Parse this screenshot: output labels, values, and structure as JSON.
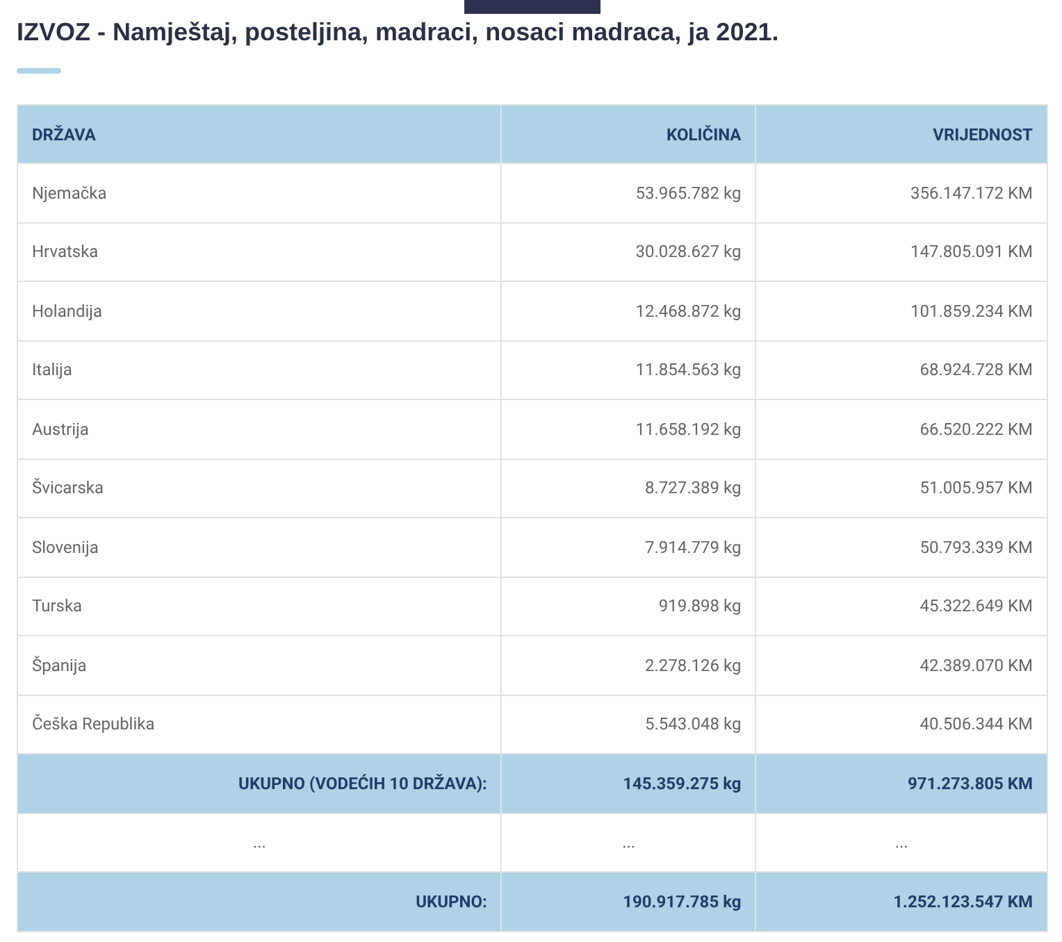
{
  "title": "IZVOZ - Namještaj, posteljina, madraci, nosaci madraca, ja 2021.",
  "table": {
    "columns": [
      "DRŽAVA",
      "KOLIČINA",
      "VRIJEDNOST"
    ],
    "rows": [
      {
        "kind": "data",
        "cells": [
          "Njemačka",
          "53.965.782 kg",
          "356.147.172 KM"
        ]
      },
      {
        "kind": "data",
        "cells": [
          "Hrvatska",
          "30.028.627 kg",
          "147.805.091 KM"
        ]
      },
      {
        "kind": "data",
        "cells": [
          "Holandija",
          "12.468.872 kg",
          "101.859.234 KM"
        ]
      },
      {
        "kind": "data",
        "cells": [
          "Italija",
          "11.854.563 kg",
          "68.924.728 KM"
        ]
      },
      {
        "kind": "data",
        "cells": [
          "Austrija",
          "11.658.192 kg",
          "66.520.222 KM"
        ]
      },
      {
        "kind": "data",
        "cells": [
          "Švicarska",
          "8.727.389 kg",
          "51.005.957 KM"
        ]
      },
      {
        "kind": "data",
        "cells": [
          "Slovenija",
          "7.914.779 kg",
          "50.793.339 KM"
        ]
      },
      {
        "kind": "data",
        "cells": [
          "Turska",
          "919.898 kg",
          "45.322.649 KM"
        ]
      },
      {
        "kind": "data",
        "cells": [
          "Španija",
          "2.278.126 kg",
          "42.389.070 KM"
        ]
      },
      {
        "kind": "data",
        "cells": [
          "Češka Republika",
          "5.543.048 kg",
          "40.506.344 KM"
        ]
      },
      {
        "kind": "total",
        "cells": [
          "UKUPNO (VODEĆIH 10 DRŽAVA):",
          "145.359.275 kg",
          "971.273.805 KM"
        ]
      },
      {
        "kind": "gap",
        "cells": [
          "...",
          "...",
          "..."
        ]
      },
      {
        "kind": "total",
        "cells": [
          "UKUPNO:",
          "190.917.785 kg",
          "1.252.123.547 KM"
        ]
      }
    ]
  }
}
